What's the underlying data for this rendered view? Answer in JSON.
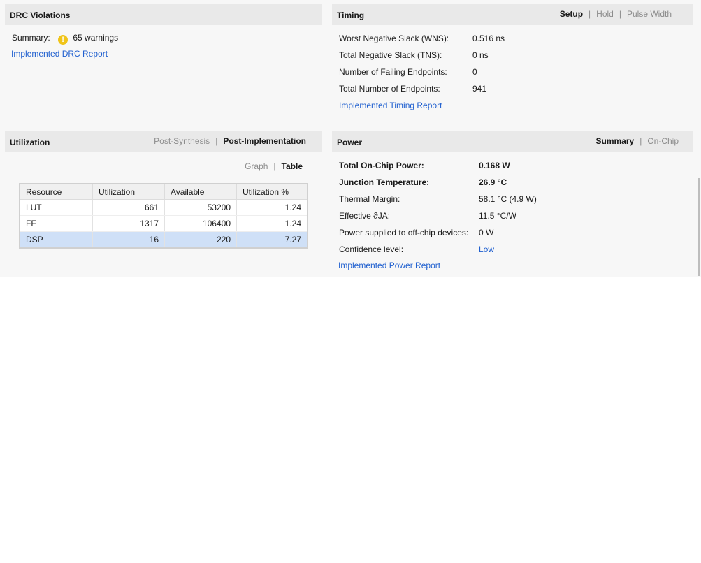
{
  "drc": {
    "title": "DRC Violations",
    "summary_label": "Summary:",
    "warning_icon_glyph": "!",
    "warnings_text": "65 warnings",
    "report_link": "Implemented DRC Report",
    "icon": "warning-icon"
  },
  "timing": {
    "title": "Timing",
    "tabs": [
      {
        "label": "Setup",
        "active": true
      },
      {
        "label": "Hold",
        "active": false
      },
      {
        "label": "Pulse Width",
        "active": false
      }
    ],
    "rows": [
      {
        "label": "Worst Negative Slack (WNS):",
        "value": "0.516 ns"
      },
      {
        "label": "Total Negative Slack (TNS):",
        "value": "0 ns"
      },
      {
        "label": "Number of Failing Endpoints:",
        "value": "0"
      },
      {
        "label": "Total Number of Endpoints:",
        "value": "941"
      }
    ],
    "report_link": "Implemented Timing Report"
  },
  "utilization": {
    "title": "Utilization",
    "tabs": [
      {
        "label": "Post-Synthesis",
        "active": false
      },
      {
        "label": "Post-Implementation",
        "active": true
      }
    ],
    "view_tabs": [
      {
        "label": "Graph",
        "active": false
      },
      {
        "label": "Table",
        "active": true
      }
    ],
    "columns": [
      "Resource",
      "Utilization",
      "Available",
      "Utilization %"
    ],
    "rows": [
      {
        "resource": "LUT",
        "utilization": "661",
        "available": "53200",
        "percent": "1.24",
        "selected": false
      },
      {
        "resource": "FF",
        "utilization": "1317",
        "available": "106400",
        "percent": "1.24",
        "selected": false
      },
      {
        "resource": "DSP",
        "utilization": "16",
        "available": "220",
        "percent": "7.27",
        "selected": true
      }
    ]
  },
  "power": {
    "title": "Power",
    "tabs": [
      {
        "label": "Summary",
        "active": true
      },
      {
        "label": "On-Chip",
        "active": false
      }
    ],
    "rows": [
      {
        "label": "Total On-Chip Power:",
        "value": "0.168 W",
        "bold": true
      },
      {
        "label": "Junction Temperature:",
        "value": "26.9 °C",
        "bold": true
      },
      {
        "label": "Thermal Margin:",
        "value": "58.1 °C (4.9 W)",
        "bold": false
      },
      {
        "label": "Effective ϑJA:",
        "value": "11.5 °C/W",
        "bold": false
      },
      {
        "label": "Power supplied to off-chip devices:",
        "value": "0 W",
        "bold": false
      },
      {
        "label": "Confidence level:",
        "value": "Low",
        "bold": false,
        "link": true
      }
    ],
    "report_link": "Implemented Power Report"
  },
  "colors": {
    "link": "#1f5fcf",
    "header_bg": "#e9e9e9",
    "panel_bg": "#f7f7f7",
    "selected_row": "#cfe0f7",
    "warning": "#f0c419"
  }
}
